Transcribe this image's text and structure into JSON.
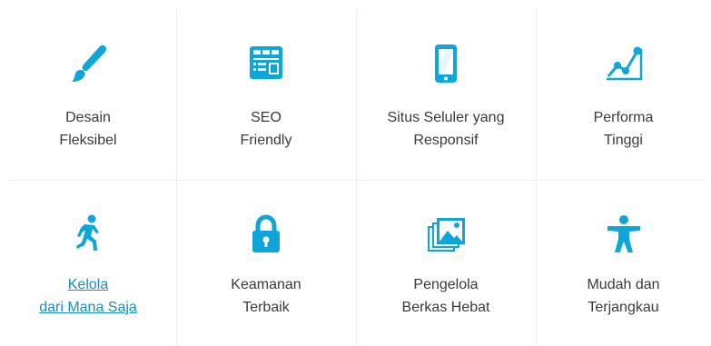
{
  "accent_color": "#0ea5d8",
  "features": [
    {
      "icon": "paintbrush-icon",
      "line1": "Desain",
      "line2": "Fleksibel",
      "link": false
    },
    {
      "icon": "seo-browser-icon",
      "line1": "SEO",
      "line2": "Friendly",
      "link": false
    },
    {
      "icon": "mobile-phone-icon",
      "line1": "Situs Seluler yang",
      "line2": "Responsif",
      "link": false
    },
    {
      "icon": "line-chart-icon",
      "line1": "Performa",
      "line2": "Tinggi",
      "link": false
    },
    {
      "icon": "running-person-icon",
      "line1": "Kelola",
      "line2": "dari Mana Saja",
      "link": true
    },
    {
      "icon": "padlock-icon",
      "line1": "Keamanan",
      "line2": "Terbaik",
      "link": false
    },
    {
      "icon": "image-gallery-icon",
      "line1": "Pengelola",
      "line2": "Berkas Hebat",
      "link": false
    },
    {
      "icon": "accessibility-person-icon",
      "line1": "Mudah dan",
      "line2": "Terjangkau",
      "link": false
    }
  ]
}
